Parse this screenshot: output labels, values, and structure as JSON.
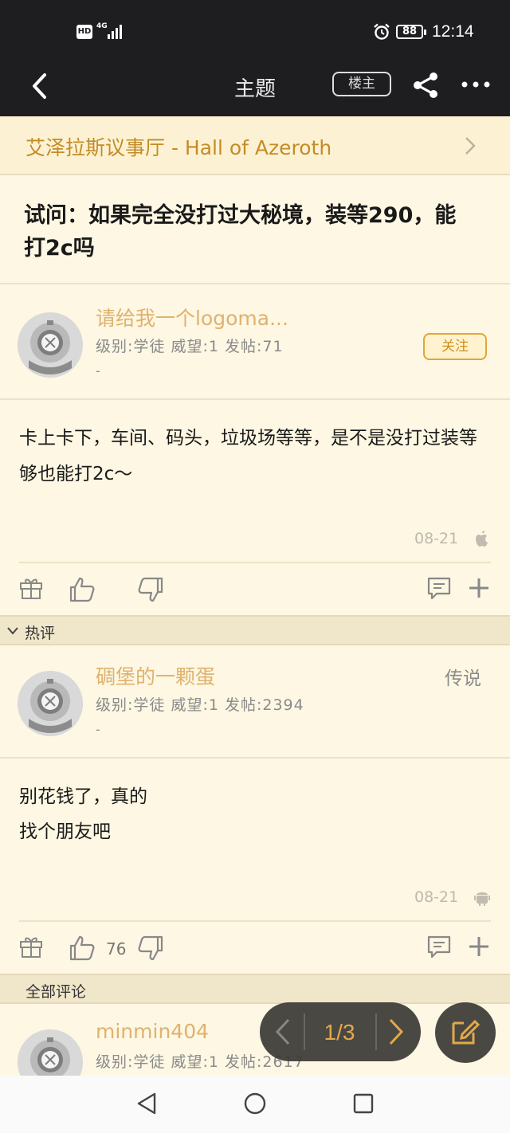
{
  "status": {
    "hd": "HD",
    "network": "4G",
    "battery": "88",
    "time": "12:14"
  },
  "nav": {
    "title": "主题",
    "op_only": "楼主"
  },
  "forum": {
    "name": "艾泽拉斯议事厅 - Hall of Azeroth"
  },
  "thread": {
    "title": "试问：如果完全没打过大秘境，装等290，能打2c吗"
  },
  "op": {
    "username": "请给我一个logoma...",
    "meta": "级别:学徒 威望:1 发帖:71",
    "signature": "-",
    "follow": "关注",
    "content": "卡上卡下，车间、码头，垃圾场等等，是不是没打过装等够也能打2c～",
    "date": "08-21",
    "device": "apple-icon"
  },
  "hot_section": {
    "label": "热评"
  },
  "hot_reply": {
    "username": "碉堡的一颗蛋",
    "meta": "级别:学徒 威望:1 发帖:2394",
    "signature": "-",
    "badge": "传说",
    "line1": "别花钱了，真的",
    "line2": "找个朋友吧",
    "date": "08-21",
    "device": "android-icon",
    "likes": "76"
  },
  "all_section": {
    "label": "全部评论"
  },
  "reply3": {
    "username": "minmin404",
    "meta": "级别:学徒 威望:1 发帖:2617"
  },
  "pager": {
    "page": "1/3"
  },
  "colors": {
    "accent": "#c58b27",
    "bg": "#fdf7e3",
    "dark": "#1e1e21"
  }
}
